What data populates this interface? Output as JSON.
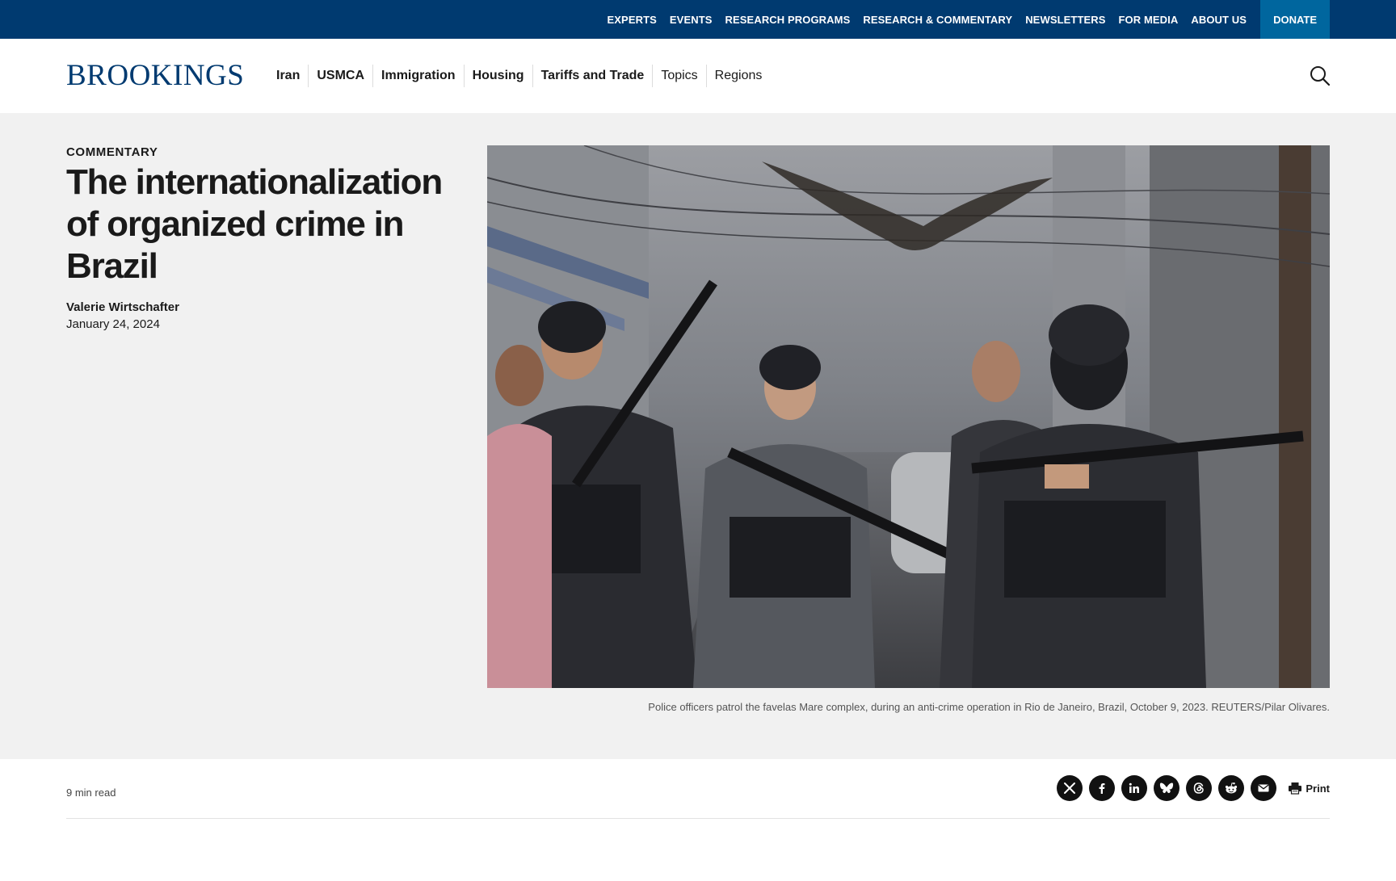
{
  "utility_nav": {
    "links": [
      "EXPERTS",
      "EVENTS",
      "RESEARCH PROGRAMS",
      "RESEARCH & COMMENTARY",
      "NEWSLETTERS",
      "FOR MEDIA",
      "ABOUT US"
    ],
    "donate_label": "DONATE"
  },
  "header": {
    "logo_text": "BROOKINGS",
    "nav": [
      {
        "label": "Iran"
      },
      {
        "label": "USMCA"
      },
      {
        "label": "Immigration"
      },
      {
        "label": "Housing"
      },
      {
        "label": "Tariffs and Trade"
      },
      {
        "label": "Topics"
      },
      {
        "label": "Regions"
      }
    ],
    "search_icon": "search-icon"
  },
  "article": {
    "type_label": "COMMENTARY",
    "title": "The internationalization of organized crime in Brazil",
    "author": "Valerie Wirtschafter",
    "date": "January 24, 2024",
    "image_caption": "Police officers patrol the favelas Mare complex, during an anti-crime operation in Rio de Janeiro, Brazil, October 9, 2023. REUTERS/Pilar Olivares.",
    "read_time": "9 min read"
  },
  "share": {
    "icons": [
      "x-icon",
      "facebook-icon",
      "linkedin-icon",
      "bluesky-icon",
      "threads-icon",
      "reddit-icon",
      "email-icon"
    ],
    "print_label": "Print"
  },
  "colors": {
    "utility_bar": "#003a70",
    "donate": "#00669e",
    "hero_bg": "#f1f1f1",
    "logo": "#003a70"
  }
}
